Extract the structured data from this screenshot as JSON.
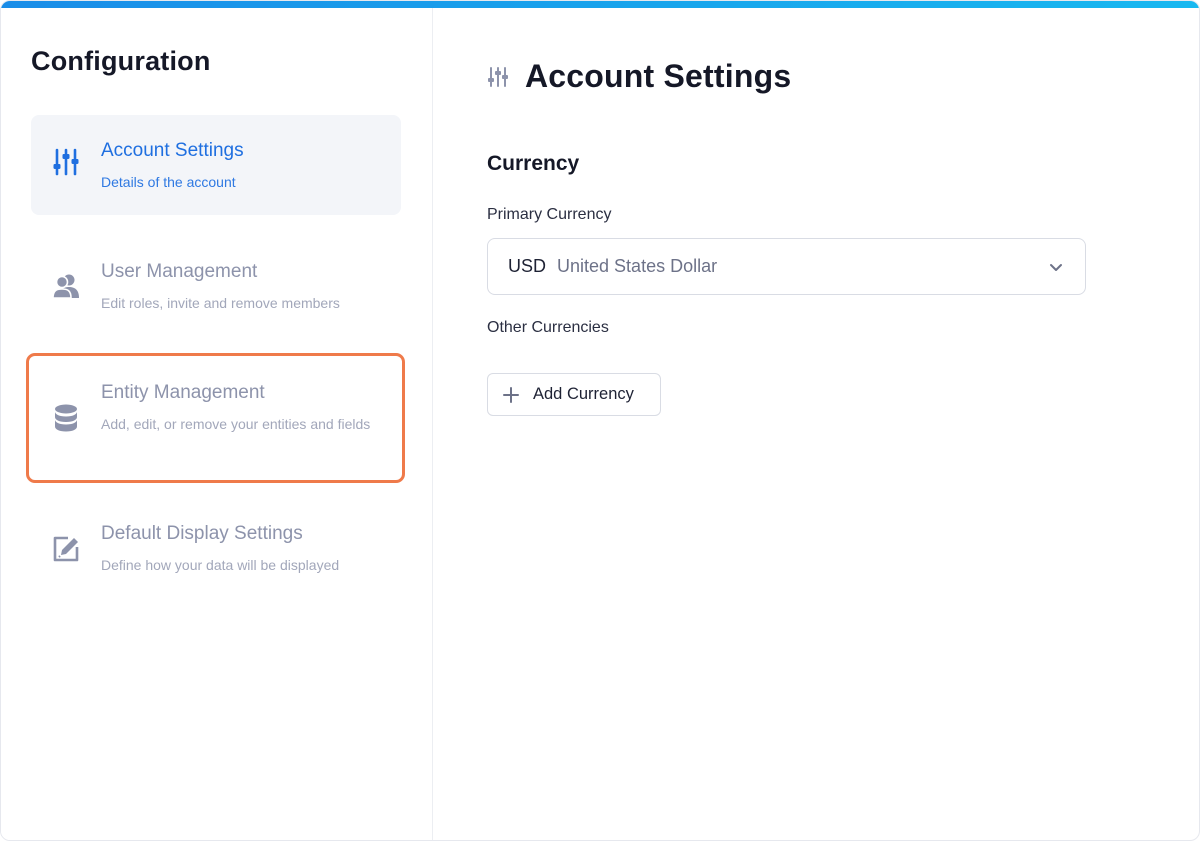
{
  "sidebar": {
    "title": "Configuration",
    "items": [
      {
        "label": "Account Settings",
        "description": "Details of the account",
        "icon": "sliders-icon",
        "state": "active"
      },
      {
        "label": "User Management",
        "description": "Edit roles, invite and remove members",
        "icon": "users-icon",
        "state": "default"
      },
      {
        "label": "Entity Management",
        "description": "Add, edit, or remove your entities and fields",
        "icon": "database-icon",
        "state": "highlighted"
      },
      {
        "label": "Default Display Settings",
        "description": "Define how your data will be displayed",
        "icon": "edit-square-icon",
        "state": "default"
      }
    ]
  },
  "main": {
    "title": "Account Settings",
    "title_icon": "sliders-icon",
    "section_title": "Currency",
    "primary_currency_label": "Primary Currency",
    "primary_currency": {
      "code": "USD",
      "name": "United States Dollar"
    },
    "other_currencies_label": "Other Currencies",
    "add_currency_label": "Add Currency"
  },
  "colors": {
    "accent": "#1f6fe0",
    "highlight_border": "#ef7a4a",
    "top_bar": "#1a8de8",
    "active_bg": "#f3f5f9",
    "muted_text": "#8d93ab"
  }
}
